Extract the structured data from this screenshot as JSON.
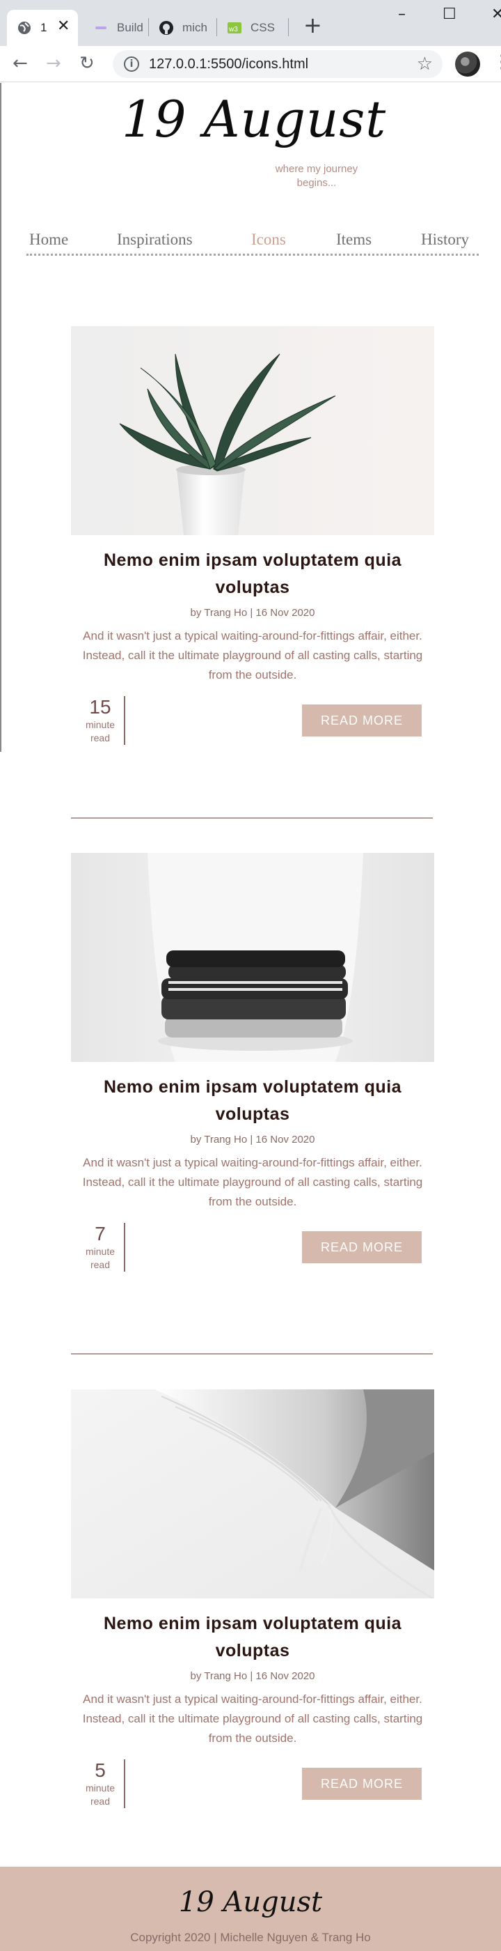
{
  "browser": {
    "tabs": [
      {
        "title": "1",
        "icon": "globe-icon"
      },
      {
        "title": "Build",
        "icon": "build-icon"
      },
      {
        "title": "mich",
        "icon": "github-icon"
      },
      {
        "title": "CSS",
        "icon": "w3-icon"
      }
    ],
    "url": "127.0.0.1:5500/icons.html"
  },
  "site": {
    "logo": "19 August",
    "tagline": "where my journey begins...",
    "nav": [
      {
        "label": "Home"
      },
      {
        "label": "Inspirations"
      },
      {
        "label": "Icons",
        "active": true
      },
      {
        "label": "Items"
      },
      {
        "label": "History"
      }
    ],
    "accent_color": "#c9a191",
    "button_color": "#d5b9ad"
  },
  "posts": [
    {
      "image": "plant-photo",
      "title": "Nemo enim ipsam voluptatem quia voluptas",
      "meta": "by Trang Ho | 16 Nov 2020",
      "excerpt": "And it wasn't just a typical waiting-around-for-fittings affair, either. Instead, call it the ultimate playground of all casting calls, starting from the outside.",
      "read_minutes": "15",
      "read_unit": "minute read",
      "button": "READ MORE"
    },
    {
      "image": "folded-clothes-photo",
      "title": "Nemo enim ipsam voluptatem quia voluptas",
      "meta": "by Trang Ho | 16 Nov 2020",
      "excerpt": "And it wasn't just a typical waiting-around-for-fittings affair, either. Instead, call it the ultimate playground of all casting calls, starting from the outside.",
      "read_minutes": "7",
      "read_unit": "minute read",
      "button": "READ MORE"
    },
    {
      "image": "open-book-photo",
      "title": "Nemo enim ipsam voluptatem quia voluptas",
      "meta": "by Trang Ho | 16 Nov 2020",
      "excerpt": "And it wasn't just a typical waiting-around-for-fittings affair, either. Instead, call it the ultimate playground of all casting calls, starting from the outside.",
      "read_minutes": "5",
      "read_unit": "minute read",
      "button": "READ MORE"
    }
  ],
  "footer": {
    "logo": "19 August",
    "copyright": "Copyright 2020 | Michelle Nguyen & Trang Ho"
  }
}
